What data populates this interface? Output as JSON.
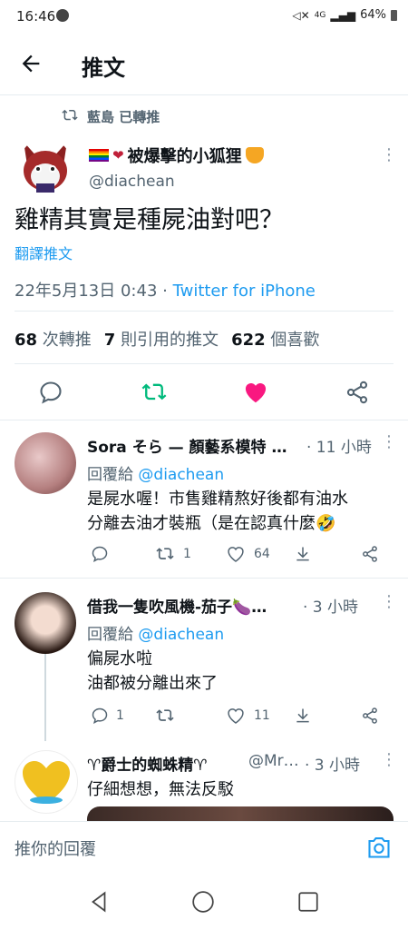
{
  "status_bar": {
    "time": "16:46",
    "battery": "64%",
    "network": "4G"
  },
  "header": {
    "title": "推文"
  },
  "retweet_banner": {
    "text": "藍島 已轉推"
  },
  "tweet": {
    "name": "被爆擊的小狐狸",
    "handle": "@diachean",
    "text": "雞精其實是種屍油對吧？",
    "translate": "翻譯推文",
    "timestamp": "22年5月13日 0:43 · ",
    "source": "Twitter for iPhone",
    "retweets": "68",
    "retweets_label": "次轉推",
    "quotes": "7",
    "quotes_label": "則引用的推文",
    "likes": "622",
    "likes_label": "個喜歡"
  },
  "replies": [
    {
      "name": "Sora そら — 顏藝系模特 …",
      "time": "· 11 小時",
      "reply_to_label": "回覆給",
      "reply_to": "@diachean",
      "line1": "是屍水喔！市售雞精熬好後都有油水",
      "line2": "分離去油才裝瓶（是在認真什麼🤣",
      "replies": "",
      "retweets": "1",
      "likes": "64"
    },
    {
      "name": "借我一隻吹風機-茄子🍆…",
      "time": "· 3 小時",
      "reply_to_label": "回覆給",
      "reply_to": "@diachean",
      "line1": "偏屍水啦",
      "line2": "油都被分離出來了",
      "replies": "1",
      "retweets": "",
      "likes": "11"
    },
    {
      "name": "♈爵士的蜘蛛精♈",
      "handle": "@Mr…",
      "time": "· 3 小時",
      "line1": "仔細想想，無法反駁"
    }
  ],
  "compose": {
    "placeholder": "推你的回覆"
  },
  "colors": {
    "accent": "#1d9bf0",
    "retweet": "#00ba7c",
    "like": "#f91880"
  }
}
